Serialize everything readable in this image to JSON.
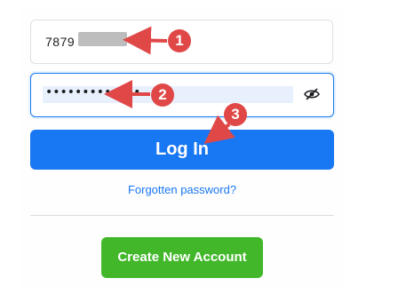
{
  "login_form": {
    "email_value": "7879",
    "password_dots": "•••••••••••••",
    "password_visibility_icon": "eye-off-icon",
    "login_label": "Log In",
    "forgot_label": "Forgotten password?",
    "create_account_label": "Create New Account"
  },
  "annotations": {
    "step_1": "1",
    "step_2": "2",
    "step_3": "3"
  },
  "colors": {
    "primary": "#1877f2",
    "create_account": "#42b72a",
    "annotation_red": "#e04848"
  }
}
